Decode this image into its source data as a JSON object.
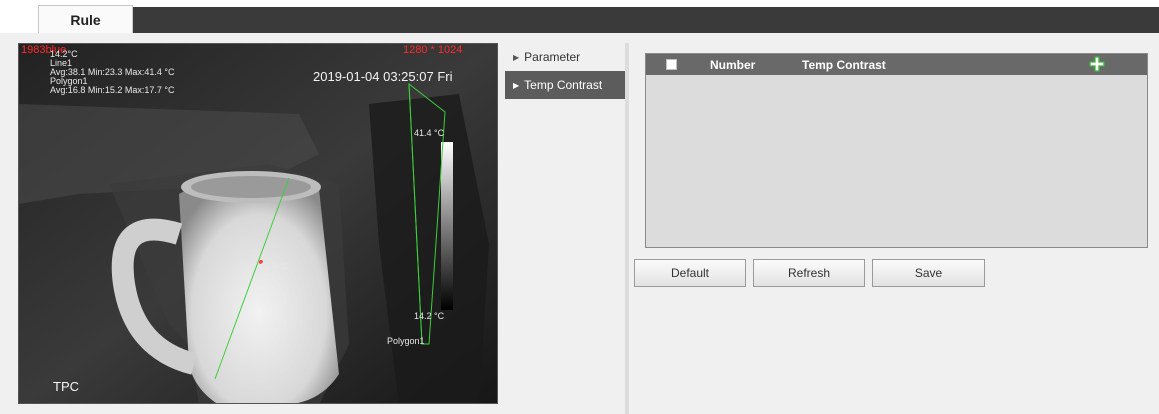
{
  "header": {
    "tab_label": "Rule"
  },
  "video": {
    "resolution_left": "1983blue",
    "resolution_right": "1280 * 1024",
    "overlay_line1": "14.2°C",
    "overlay_line2": "Line1",
    "overlay_line3": "Avg:38.1 Min:23.3 Max:41.4 °C",
    "overlay_line4": "Polygon1",
    "overlay_line5": "Avg:16.8 Min:15.2 Max:17.7 °C",
    "timestamp": "2019-01-04 03:25:07 Fri",
    "scale_max": "41.4 °C",
    "scale_min": "14.2 °C",
    "line_temp": "41.4 °C",
    "line_label": "Line1",
    "polygon_label": "Polygon1",
    "channel_label": "TPC"
  },
  "menu": {
    "items": [
      {
        "label": "Parameter",
        "active": false
      },
      {
        "label": "Temp Contrast",
        "active": true
      }
    ]
  },
  "table": {
    "columns": [
      "Number",
      "Temp Contrast"
    ],
    "rows": []
  },
  "buttons": {
    "default_label": "Default",
    "refresh_label": "Refresh",
    "save_label": "Save"
  },
  "colors": {
    "active_menu_bg": "#5c5c5c",
    "table_header_bg": "#696969",
    "add_icon": "#3cb43c",
    "overlay_red": "#ff2a2a",
    "rule_line": "#3ccf3c"
  },
  "icons": [
    "menu-arrow-icon",
    "add-icon",
    "checkbox"
  ]
}
